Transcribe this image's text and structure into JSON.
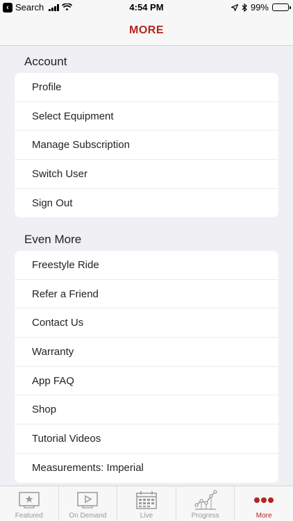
{
  "status_bar": {
    "back_app": "Search",
    "time": "4:54 PM",
    "battery": "99%",
    "battery_level": 0.99
  },
  "nav": {
    "title": "MORE"
  },
  "sections": [
    {
      "header": "Account",
      "items": [
        "Profile",
        "Select Equipment",
        "Manage Subscription",
        "Switch User",
        "Sign Out"
      ]
    },
    {
      "header": "Even More",
      "items": [
        "Freestyle Ride",
        "Refer a Friend",
        "Contact Us",
        "Warranty",
        "App FAQ",
        "Shop",
        "Tutorial Videos",
        "Measurements: Imperial"
      ]
    }
  ],
  "tabs": [
    {
      "label": "Featured",
      "icon": "featured-icon",
      "active": false
    },
    {
      "label": "On Demand",
      "icon": "on-demand-icon",
      "active": false
    },
    {
      "label": "Live",
      "icon": "calendar-icon",
      "active": false
    },
    {
      "label": "Progress",
      "icon": "progress-chart-icon",
      "active": false
    },
    {
      "label": "More",
      "icon": "more-dots-icon",
      "active": true
    }
  ],
  "colors": {
    "accent": "#b3261e",
    "background": "#efeff4",
    "inactive_tab": "#999999"
  }
}
